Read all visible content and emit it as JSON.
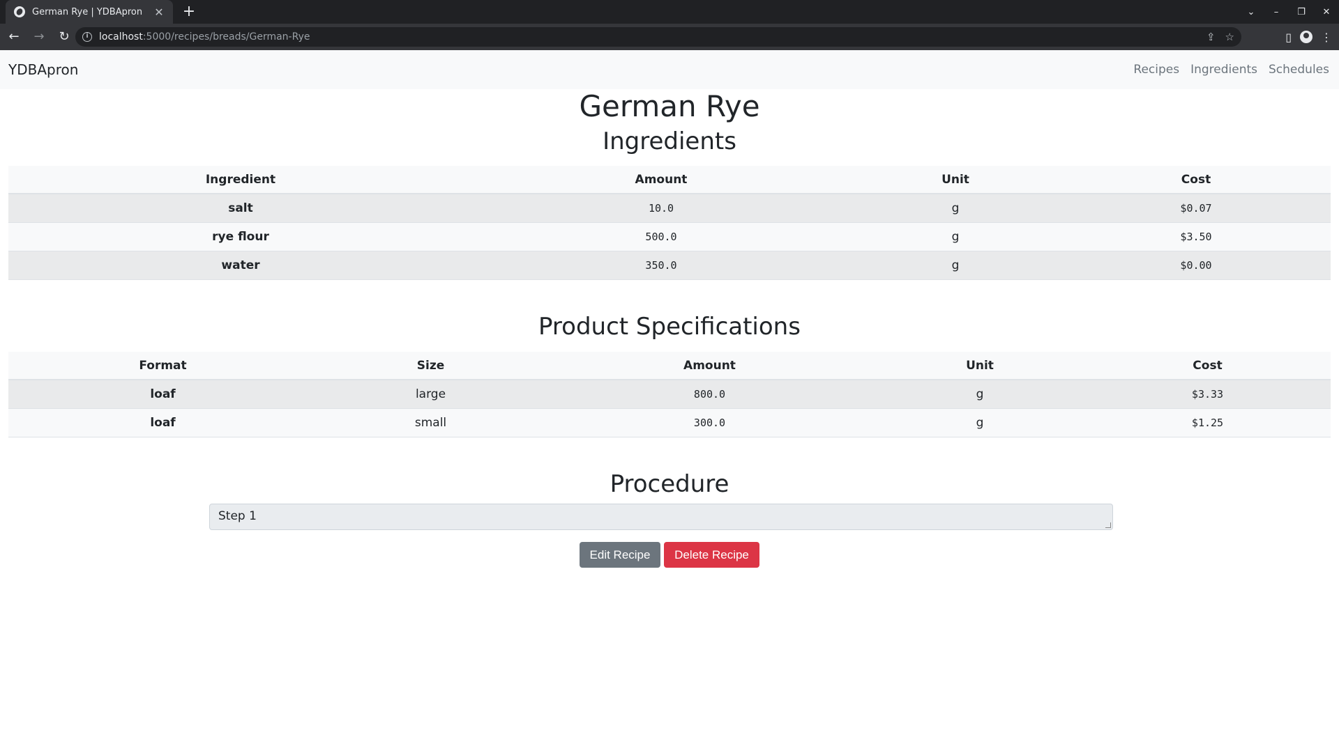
{
  "browser": {
    "tab_title": "German Rye | YDBApron",
    "tab_close": "✕",
    "new_tab": "+",
    "url_host": "localhost",
    "url_path": ":5000/recipes/breads/German-Rye",
    "window_controls": [
      "⌄",
      "–",
      "❐",
      "✕"
    ]
  },
  "navbar": {
    "brand": "YDBApron",
    "links": [
      "Recipes",
      "Ingredients",
      "Schedules"
    ]
  },
  "page": {
    "title": "German Rye"
  },
  "ingredients": {
    "heading": "Ingredients",
    "columns": [
      "Ingredient",
      "Amount",
      "Unit",
      "Cost"
    ],
    "rows": [
      [
        "salt",
        "10.0",
        "g",
        "$0.07"
      ],
      [
        "rye flour",
        "500.0",
        "g",
        "$3.50"
      ],
      [
        "water",
        "350.0",
        "g",
        "$0.00"
      ]
    ]
  },
  "specs": {
    "heading": "Product Specifications",
    "columns": [
      "Format",
      "Size",
      "Amount",
      "Unit",
      "Cost"
    ],
    "rows": [
      [
        "loaf",
        "large",
        "800.0",
        "g",
        "$3.33"
      ],
      [
        "loaf",
        "small",
        "300.0",
        "g",
        "$1.25"
      ]
    ]
  },
  "procedure": {
    "heading": "Procedure",
    "text": "Step 1"
  },
  "actions": {
    "edit": "Edit Recipe",
    "delete": "Delete Recipe"
  },
  "icons": {
    "back": "arrow-left-icon",
    "forward": "arrow-right-icon",
    "reload": "reload-icon",
    "info": "info-icon",
    "share": "share-icon",
    "bookmark": "star-icon",
    "sidepanel": "side-panel-icon",
    "profile": "profile-icon",
    "menu": "kebab-menu-icon"
  }
}
